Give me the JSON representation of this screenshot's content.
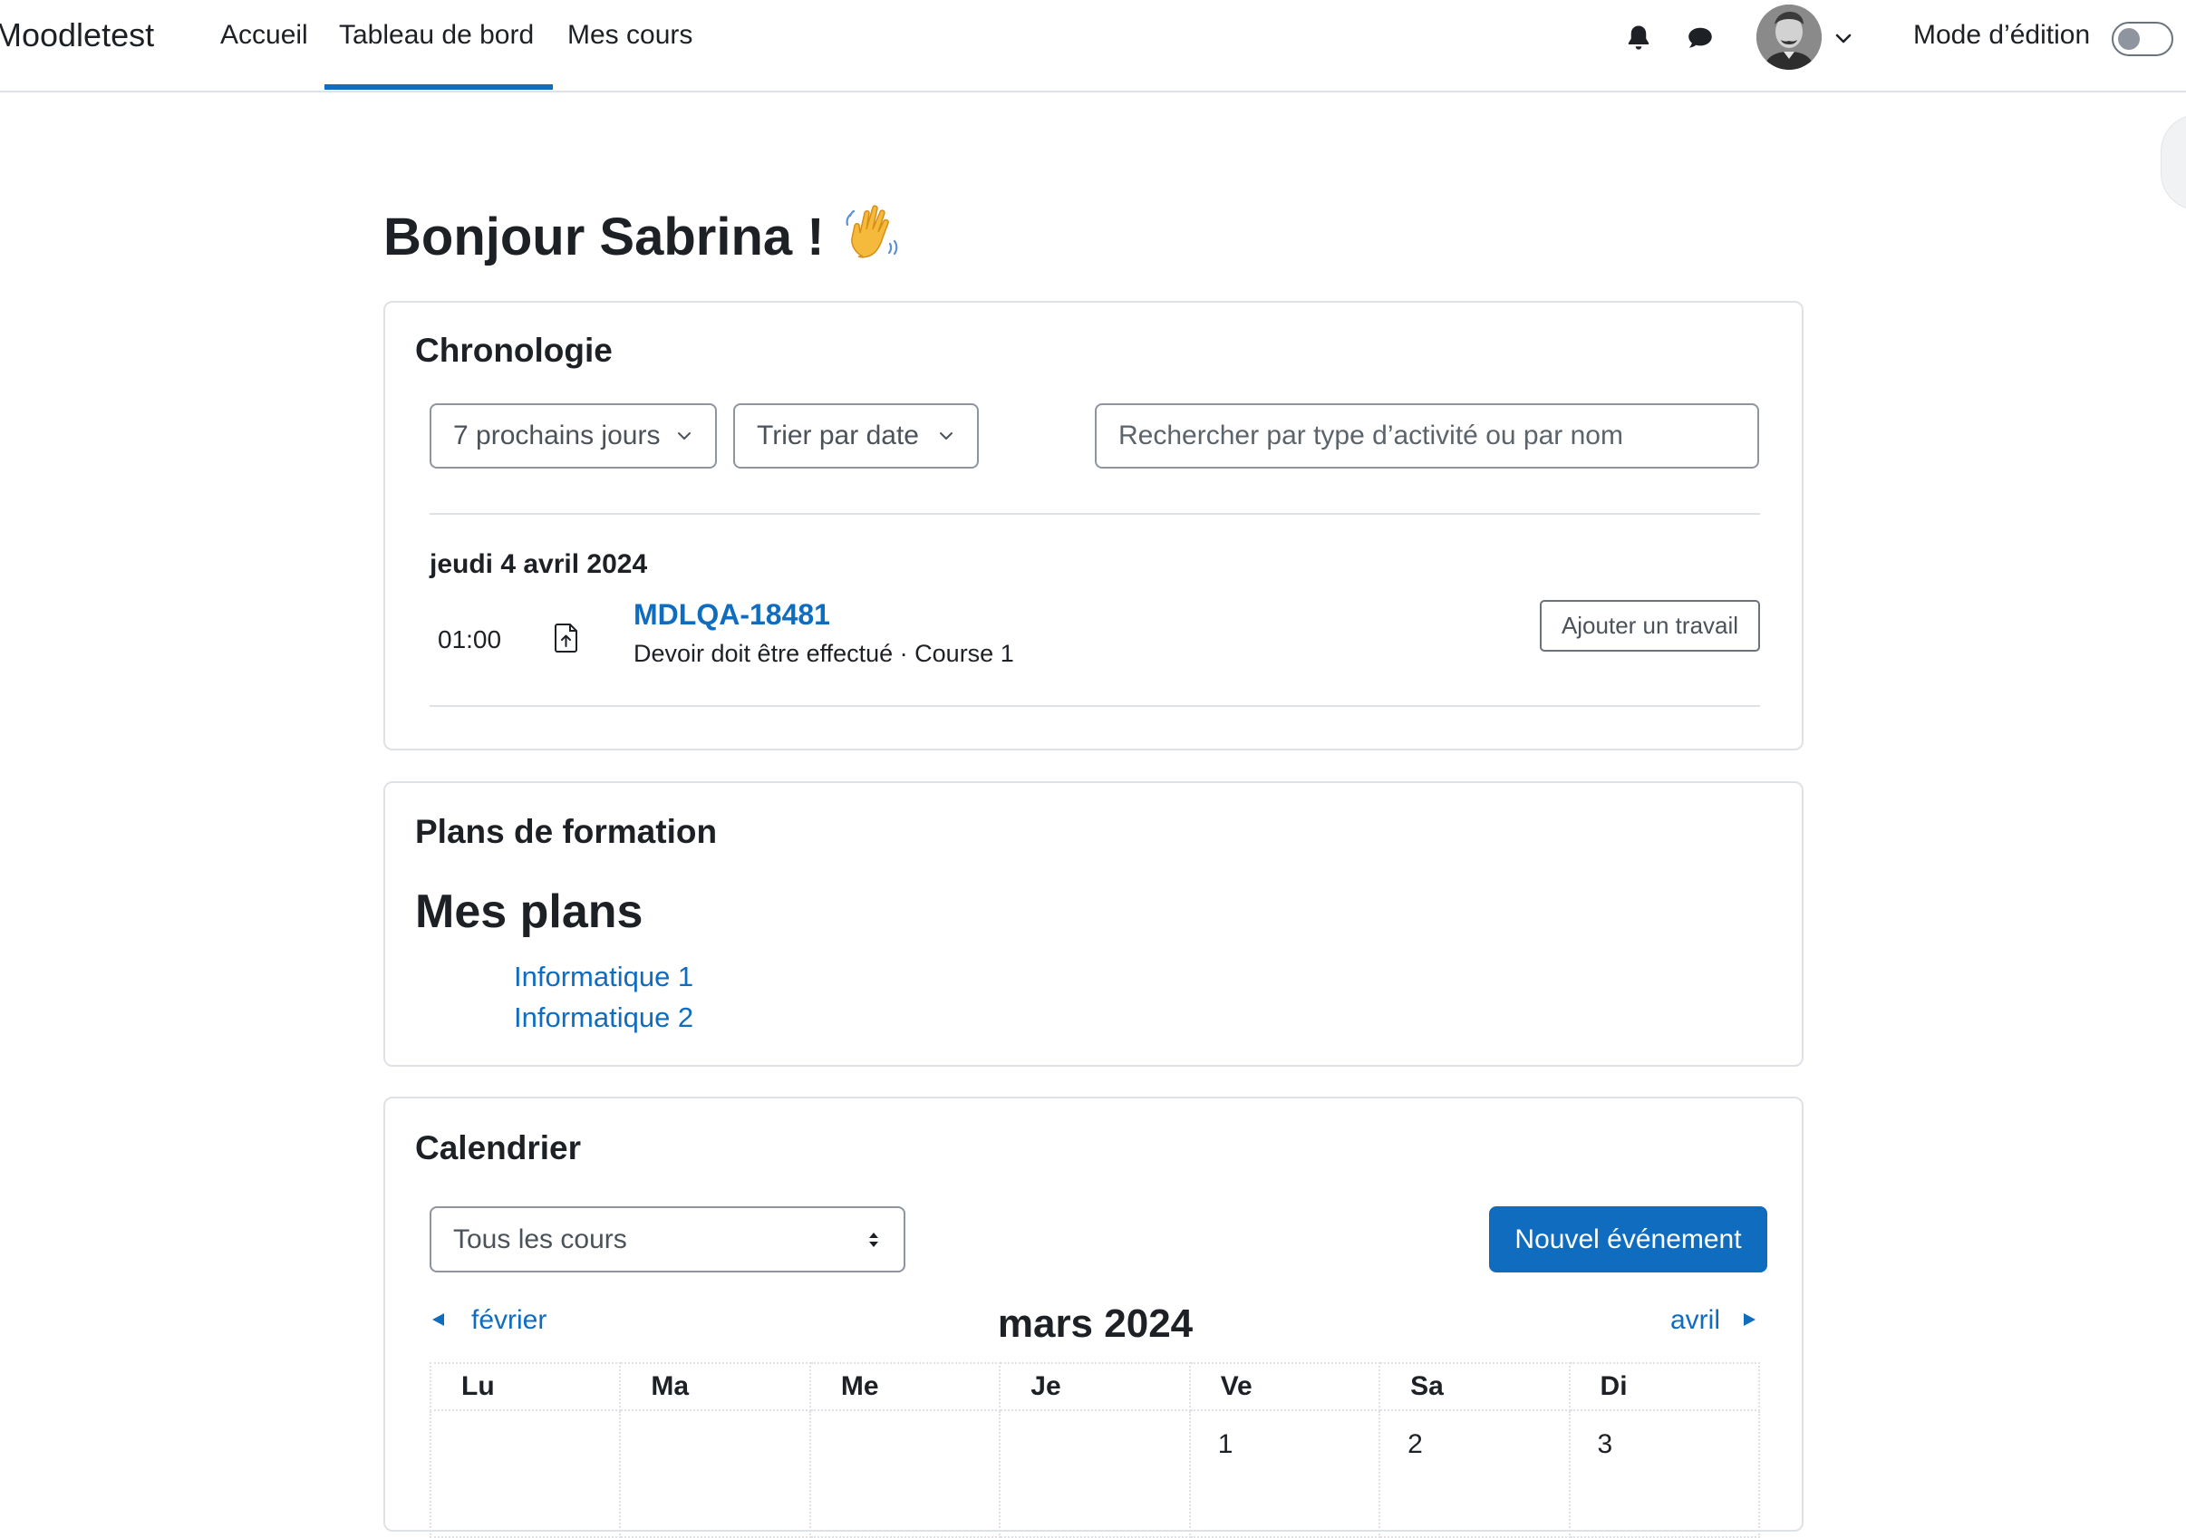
{
  "navbar": {
    "brand": "Moodletest",
    "links": [
      "Accueil",
      "Tableau de bord",
      "Mes cours"
    ],
    "active_link": "Tableau de bord",
    "edit_mode_label": "Mode d’édition",
    "edit_mode_on": false
  },
  "greeting": "Bonjour Sabrina !",
  "timeline": {
    "title": "Chronologie",
    "filter_label": "7 prochains jours",
    "sort_label": "Trier par date",
    "search_placeholder": "Rechercher par type d’activité ou par nom",
    "date_heading": "jeudi 4 avril 2024",
    "events": [
      {
        "time": "01:00",
        "icon": "assignment-upload-icon",
        "name": "MDLQA-18481",
        "description": "Devoir doit être effectué · Course 1",
        "action": "Ajouter un travail"
      }
    ]
  },
  "learning_plans": {
    "title": "Plans de formation",
    "heading": "Mes plans",
    "plans": [
      "Informatique 1",
      "Informatique 2"
    ]
  },
  "calendar": {
    "title": "Calendrier",
    "course_filter": "Tous les cours",
    "new_event_label": "Nouvel événement",
    "prev_month": "février",
    "current_month": "mars 2024",
    "next_month": "avril",
    "weekdays": [
      "Lu",
      "Ma",
      "Me",
      "Je",
      "Ve",
      "Sa",
      "Di"
    ],
    "first_week": [
      "",
      "",
      "",
      "",
      "1",
      "2",
      "3"
    ]
  },
  "colors": {
    "accent": "#0f6cbf",
    "text": "#1d2125",
    "border": "#dee2e6"
  }
}
